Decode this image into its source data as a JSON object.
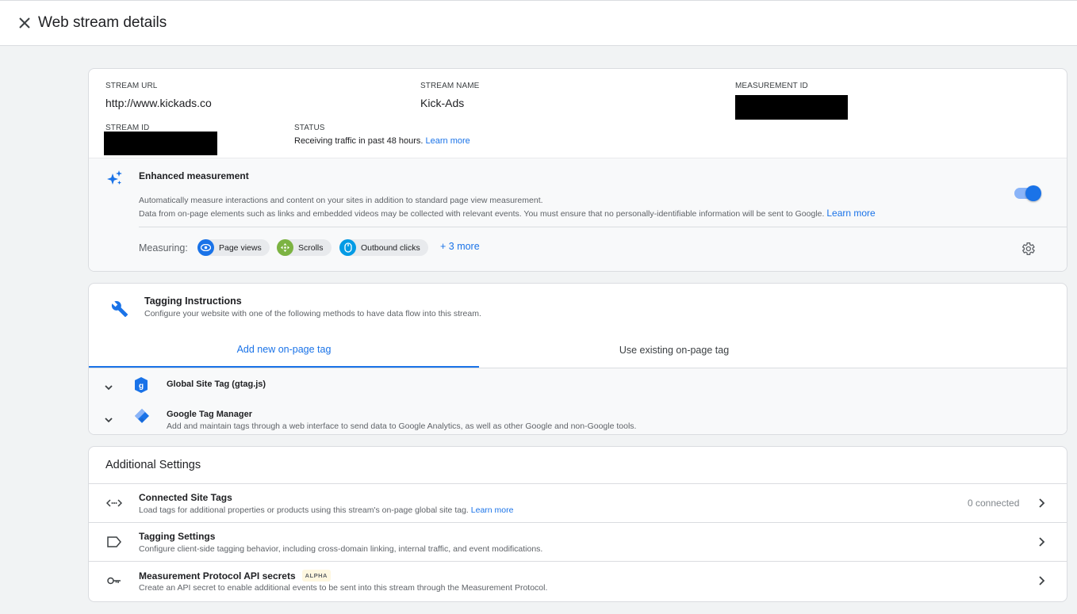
{
  "header": {
    "title": "Web stream details"
  },
  "stream": {
    "url_label": "STREAM URL",
    "url_value": "http://www.kickads.co",
    "name_label": "STREAM NAME",
    "name_value": "Kick-Ads",
    "measurement_id_label": "MEASUREMENT ID",
    "stream_id_label": "STREAM ID",
    "status_label": "STATUS",
    "status_text": "Receiving traffic in past 48 hours.",
    "status_link": "Learn more"
  },
  "enhanced": {
    "title": "Enhanced measurement",
    "desc_line1": "Automatically measure interactions and content on your sites in addition to standard page view measurement.",
    "desc_line2": "Data from on-page elements such as links and embedded videos may be collected with relevant events. You must ensure that no personally-identifiable information will be sent to Google.",
    "desc_link": "Learn more",
    "toggle_on": true,
    "measuring_label": "Measuring:",
    "chips": [
      {
        "label": "Page views",
        "icon": "eye-icon",
        "color": "#1a73e8"
      },
      {
        "label": "Scrolls",
        "icon": "scroll-icon",
        "color": "#7cb342"
      },
      {
        "label": "Outbound clicks",
        "icon": "mouse-icon",
        "color": "#039be5"
      }
    ],
    "more": "+ 3 more"
  },
  "tagging": {
    "title": "Tagging Instructions",
    "subtitle": "Configure your website with one of the following methods to have data flow into this stream.",
    "tabs": [
      "Add new on-page tag",
      "Use existing on-page tag"
    ],
    "methods": [
      {
        "title": "Global Site Tag (gtag.js)",
        "subtitle": ""
      },
      {
        "title": "Google Tag Manager",
        "subtitle": "Add and maintain tags through a web interface to send data to Google Analytics, as well as other Google and non-Google tools."
      }
    ]
  },
  "additional": {
    "title": "Additional Settings",
    "rows": [
      {
        "title": "Connected Site Tags",
        "subtitle": "Load tags for additional properties or products using this stream's on-page global site tag.",
        "link": "Learn more",
        "count": "0 connected"
      },
      {
        "title": "Tagging Settings",
        "subtitle": "Configure client-side tagging behavior, including cross-domain linking, internal traffic, and event modifications."
      },
      {
        "title": "Measurement Protocol API secrets",
        "badge": "ALPHA",
        "subtitle": "Create an API secret to enable additional events to be sent into this stream through the Measurement Protocol."
      }
    ]
  }
}
